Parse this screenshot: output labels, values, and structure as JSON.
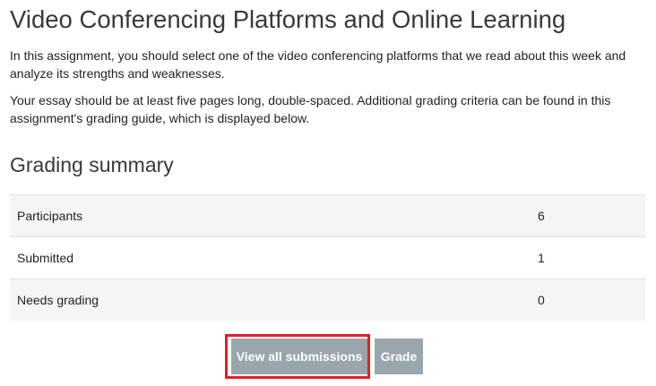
{
  "assignment": {
    "title": "Video Conferencing Platforms and Online Learning",
    "intro_1": "In this assignment, you should select one of the video conferencing platforms that we read about this week and analyze its strengths and weaknesses.",
    "intro_2": "Your essay should be at least five pages long, double-spaced.  Additional grading criteria can be found in this assignment's grading guide, which is displayed below."
  },
  "grading_summary": {
    "heading": "Grading summary",
    "rows": [
      {
        "label": "Participants",
        "value": "6"
      },
      {
        "label": "Submitted",
        "value": "1"
      },
      {
        "label": "Needs grading",
        "value": "0"
      }
    ]
  },
  "actions": {
    "view_all_label": "View all submissions",
    "grade_label": "Grade",
    "highlight_color": "#e0202a",
    "button_color": "#9aa6ad"
  }
}
